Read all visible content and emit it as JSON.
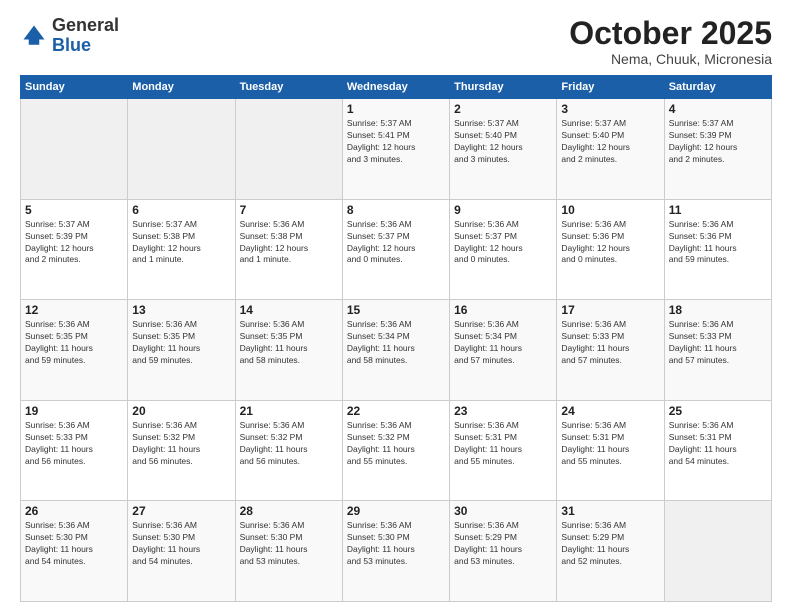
{
  "header": {
    "logo": {
      "line1": "General",
      "line2": "Blue"
    },
    "month": "October 2025",
    "location": "Nema, Chuuk, Micronesia"
  },
  "weekdays": [
    "Sunday",
    "Monday",
    "Tuesday",
    "Wednesday",
    "Thursday",
    "Friday",
    "Saturday"
  ],
  "weeks": [
    [
      {
        "day": "",
        "info": ""
      },
      {
        "day": "",
        "info": ""
      },
      {
        "day": "",
        "info": ""
      },
      {
        "day": "1",
        "info": "Sunrise: 5:37 AM\nSunset: 5:41 PM\nDaylight: 12 hours\nand 3 minutes."
      },
      {
        "day": "2",
        "info": "Sunrise: 5:37 AM\nSunset: 5:40 PM\nDaylight: 12 hours\nand 3 minutes."
      },
      {
        "day": "3",
        "info": "Sunrise: 5:37 AM\nSunset: 5:40 PM\nDaylight: 12 hours\nand 2 minutes."
      },
      {
        "day": "4",
        "info": "Sunrise: 5:37 AM\nSunset: 5:39 PM\nDaylight: 12 hours\nand 2 minutes."
      }
    ],
    [
      {
        "day": "5",
        "info": "Sunrise: 5:37 AM\nSunset: 5:39 PM\nDaylight: 12 hours\nand 2 minutes."
      },
      {
        "day": "6",
        "info": "Sunrise: 5:37 AM\nSunset: 5:38 PM\nDaylight: 12 hours\nand 1 minute."
      },
      {
        "day": "7",
        "info": "Sunrise: 5:36 AM\nSunset: 5:38 PM\nDaylight: 12 hours\nand 1 minute."
      },
      {
        "day": "8",
        "info": "Sunrise: 5:36 AM\nSunset: 5:37 PM\nDaylight: 12 hours\nand 0 minutes."
      },
      {
        "day": "9",
        "info": "Sunrise: 5:36 AM\nSunset: 5:37 PM\nDaylight: 12 hours\nand 0 minutes."
      },
      {
        "day": "10",
        "info": "Sunrise: 5:36 AM\nSunset: 5:36 PM\nDaylight: 12 hours\nand 0 minutes."
      },
      {
        "day": "11",
        "info": "Sunrise: 5:36 AM\nSunset: 5:36 PM\nDaylight: 11 hours\nand 59 minutes."
      }
    ],
    [
      {
        "day": "12",
        "info": "Sunrise: 5:36 AM\nSunset: 5:35 PM\nDaylight: 11 hours\nand 59 minutes."
      },
      {
        "day": "13",
        "info": "Sunrise: 5:36 AM\nSunset: 5:35 PM\nDaylight: 11 hours\nand 59 minutes."
      },
      {
        "day": "14",
        "info": "Sunrise: 5:36 AM\nSunset: 5:35 PM\nDaylight: 11 hours\nand 58 minutes."
      },
      {
        "day": "15",
        "info": "Sunrise: 5:36 AM\nSunset: 5:34 PM\nDaylight: 11 hours\nand 58 minutes."
      },
      {
        "day": "16",
        "info": "Sunrise: 5:36 AM\nSunset: 5:34 PM\nDaylight: 11 hours\nand 57 minutes."
      },
      {
        "day": "17",
        "info": "Sunrise: 5:36 AM\nSunset: 5:33 PM\nDaylight: 11 hours\nand 57 minutes."
      },
      {
        "day": "18",
        "info": "Sunrise: 5:36 AM\nSunset: 5:33 PM\nDaylight: 11 hours\nand 57 minutes."
      }
    ],
    [
      {
        "day": "19",
        "info": "Sunrise: 5:36 AM\nSunset: 5:33 PM\nDaylight: 11 hours\nand 56 minutes."
      },
      {
        "day": "20",
        "info": "Sunrise: 5:36 AM\nSunset: 5:32 PM\nDaylight: 11 hours\nand 56 minutes."
      },
      {
        "day": "21",
        "info": "Sunrise: 5:36 AM\nSunset: 5:32 PM\nDaylight: 11 hours\nand 56 minutes."
      },
      {
        "day": "22",
        "info": "Sunrise: 5:36 AM\nSunset: 5:32 PM\nDaylight: 11 hours\nand 55 minutes."
      },
      {
        "day": "23",
        "info": "Sunrise: 5:36 AM\nSunset: 5:31 PM\nDaylight: 11 hours\nand 55 minutes."
      },
      {
        "day": "24",
        "info": "Sunrise: 5:36 AM\nSunset: 5:31 PM\nDaylight: 11 hours\nand 55 minutes."
      },
      {
        "day": "25",
        "info": "Sunrise: 5:36 AM\nSunset: 5:31 PM\nDaylight: 11 hours\nand 54 minutes."
      }
    ],
    [
      {
        "day": "26",
        "info": "Sunrise: 5:36 AM\nSunset: 5:30 PM\nDaylight: 11 hours\nand 54 minutes."
      },
      {
        "day": "27",
        "info": "Sunrise: 5:36 AM\nSunset: 5:30 PM\nDaylight: 11 hours\nand 54 minutes."
      },
      {
        "day": "28",
        "info": "Sunrise: 5:36 AM\nSunset: 5:30 PM\nDaylight: 11 hours\nand 53 minutes."
      },
      {
        "day": "29",
        "info": "Sunrise: 5:36 AM\nSunset: 5:30 PM\nDaylight: 11 hours\nand 53 minutes."
      },
      {
        "day": "30",
        "info": "Sunrise: 5:36 AM\nSunset: 5:29 PM\nDaylight: 11 hours\nand 53 minutes."
      },
      {
        "day": "31",
        "info": "Sunrise: 5:36 AM\nSunset: 5:29 PM\nDaylight: 11 hours\nand 52 minutes."
      },
      {
        "day": "",
        "info": ""
      }
    ]
  ]
}
